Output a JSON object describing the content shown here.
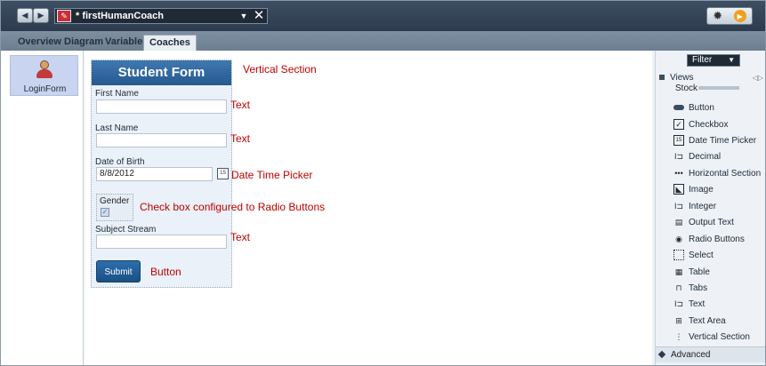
{
  "titlebar": {
    "back_icon": "back-arrow-icon",
    "forward_icon": "forward-arrow-icon",
    "document_title": "* firstHumanCoach",
    "close_glyph": "✕"
  },
  "tabs": [
    {
      "label": "Overview"
    },
    {
      "label": "Diagram"
    },
    {
      "label": "Variables"
    },
    {
      "label": "Coaches",
      "active": true
    }
  ],
  "left_panel": {
    "coach_item_label": "LoginForm"
  },
  "form": {
    "title": "Student Form",
    "first_name_label": "First Name",
    "first_name_value": "",
    "last_name_label": "Last Name",
    "last_name_value": "",
    "dob_label": "Date of Birth",
    "dob_value": "8/8/2012",
    "gender_label": "Gender",
    "subject_stream_label": "Subject Stream",
    "subject_stream_value": "",
    "submit_label": "Submit"
  },
  "annotations": {
    "vertical_section": "Vertical Section",
    "first_name": "Text",
    "last_name": "Text",
    "dob": "Date Time Picker",
    "gender": "Check box configured to Radio Buttons",
    "subject_stream": "Text",
    "submit": "Button"
  },
  "palette": {
    "filter_label": "Filter",
    "views_label": "Views",
    "stock_label": "Stock",
    "items": [
      {
        "label": "Button",
        "icon": "button-icon"
      },
      {
        "label": "Checkbox",
        "icon": "checkbox-icon"
      },
      {
        "label": "Date Time Picker",
        "icon": "calendar-icon"
      },
      {
        "label": "Decimal",
        "icon": "decimal-field-icon"
      },
      {
        "label": "Horizontal Section",
        "icon": "horizontal-section-icon"
      },
      {
        "label": "Image",
        "icon": "image-icon"
      },
      {
        "label": "Integer",
        "icon": "integer-field-icon"
      },
      {
        "label": "Output Text",
        "icon": "output-text-icon"
      },
      {
        "label": "Radio Buttons",
        "icon": "radio-icon"
      },
      {
        "label": "Select",
        "icon": "select-icon"
      },
      {
        "label": "Table",
        "icon": "table-icon"
      },
      {
        "label": "Tabs",
        "icon": "tabs-icon"
      },
      {
        "label": "Text",
        "icon": "text-field-icon"
      },
      {
        "label": "Text Area",
        "icon": "text-area-icon"
      },
      {
        "label": "Vertical Section",
        "icon": "vertical-section-icon"
      }
    ],
    "advanced_label": "Advanced"
  },
  "colors": {
    "titlebar": "#34455a",
    "form_header": "#2f6aa3",
    "annotation_red": "#c00000"
  }
}
